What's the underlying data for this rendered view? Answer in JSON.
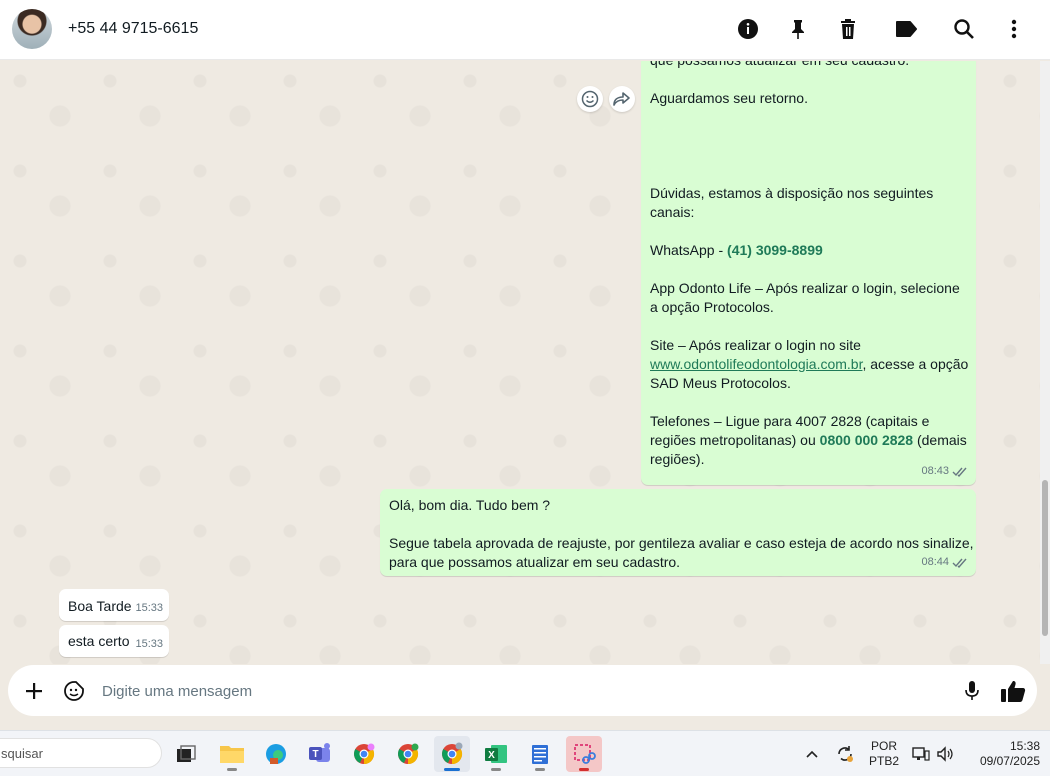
{
  "header": {
    "contact": "+55 44 9715-6615",
    "icons": [
      "info-icon",
      "pin-icon",
      "delete-icon",
      "label-icon",
      "search-icon",
      "menu-icon"
    ]
  },
  "messages": {
    "m1_partial": "que possamos atualizar em seu cadastro.",
    "m1_wait": "Aguardamos seu retorno.",
    "m1_doubts": "Dúvidas, estamos à disposição nos seguintes canais:",
    "m1_whatsapp_label": "WhatsApp - ",
    "m1_whatsapp_number": "(41) 3099-8899",
    "m1_app": "App Odonto Life – Após realizar o login, selecione a opção Protocolos.",
    "m1_site_a": "Site – Após realizar o login no site ",
    "m1_site_link": "www.odontolifeodontologia.com.br",
    "m1_site_b": ", acesse a opção SAD Meus Protocolos.",
    "m1_phone_a": "Telefones – Ligue para 4007 2828 (capitais e regiões metropolitanas) ou ",
    "m1_phone_number": "0800 000 2828",
    "m1_phone_b": " (demais regiões).",
    "m1_time": "08:43",
    "m2_line1": "Olá, bom dia. Tudo bem ?",
    "m2_line2": "Segue tabela aprovada de reajuste, por gentileza avaliar e caso esteja de acordo nos sinalize, para que possamos atualizar em seu cadastro.",
    "m2_time": "08:44",
    "m3_text": "Boa Tarde",
    "m3_time": "15:33",
    "m4_text": "esta certo",
    "m4_time": "15:33"
  },
  "composer": {
    "placeholder": "Digite uma mensagem"
  },
  "taskbar": {
    "search_text": "squisar",
    "lang_line1": "POR",
    "lang_line2": "PTB2",
    "time": "15:38",
    "date": "09/07/2025"
  },
  "colors": {
    "outgoing": "#d9fdd3",
    "incoming": "#ffffff",
    "accent_green": "#1f7a58",
    "read_ticks": "#667781"
  }
}
